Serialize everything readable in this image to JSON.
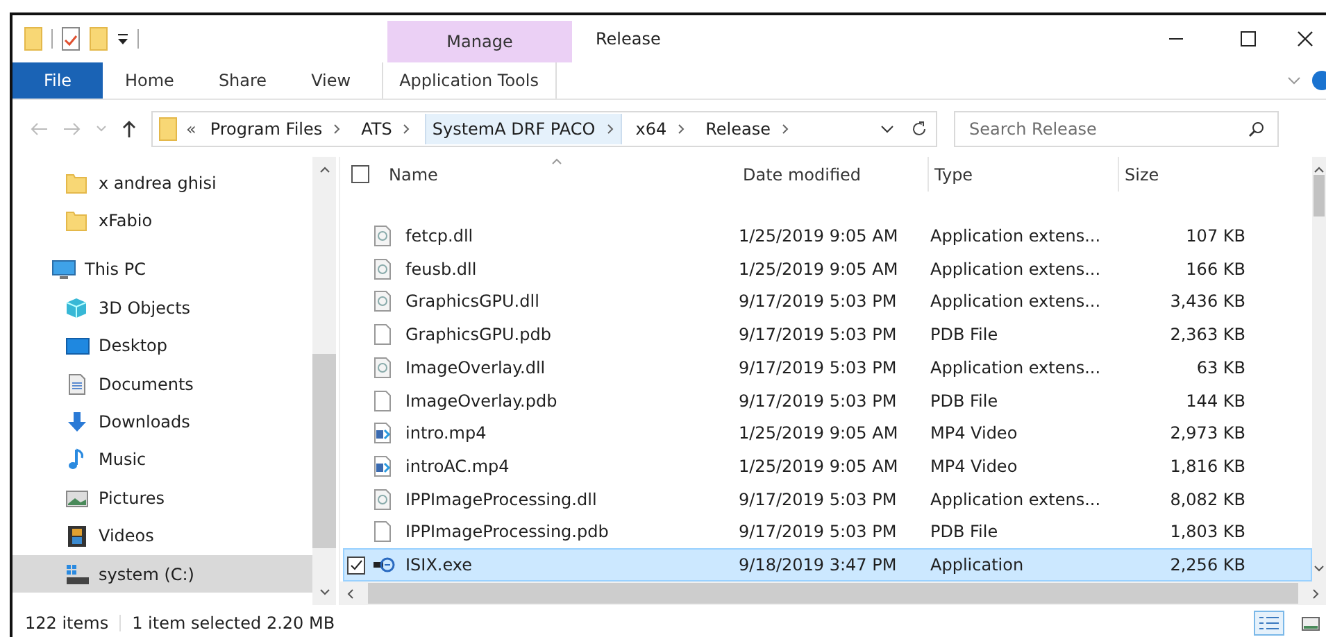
{
  "window": {
    "title": "Release",
    "contextual_group": "Manage"
  },
  "tabs": [
    {
      "label": "File",
      "selected": true
    },
    {
      "label": "Home",
      "selected": false
    },
    {
      "label": "Share",
      "selected": false
    },
    {
      "label": "View",
      "selected": false
    },
    {
      "label": "Application Tools",
      "selected": false
    }
  ],
  "address": {
    "overflow": "«",
    "crumbs": [
      {
        "label": "Program Files",
        "hover": false
      },
      {
        "label": "ATS",
        "hover": false
      },
      {
        "label": "SystemA DRF PACO",
        "hover": true
      },
      {
        "label": "x64",
        "hover": false
      },
      {
        "label": "Release",
        "hover": false
      }
    ]
  },
  "search": {
    "placeholder": "Search Release"
  },
  "sidebar": {
    "items": [
      {
        "label": "x andrea ghisi",
        "kind": "folder",
        "selected": false
      },
      {
        "label": "xFabio",
        "kind": "folder",
        "selected": false
      },
      {
        "label": "This PC",
        "kind": "pc",
        "selected": false,
        "children": [
          {
            "label": "3D Objects",
            "kind": "objects",
            "selected": false
          },
          {
            "label": "Desktop",
            "kind": "desktop",
            "selected": false
          },
          {
            "label": "Documents",
            "kind": "documents",
            "selected": false
          },
          {
            "label": "Downloads",
            "kind": "downloads",
            "selected": false
          },
          {
            "label": "Music",
            "kind": "music",
            "selected": false
          },
          {
            "label": "Pictures",
            "kind": "pictures",
            "selected": false
          },
          {
            "label": "Videos",
            "kind": "videos",
            "selected": false
          },
          {
            "label": "system (C:)",
            "kind": "drive",
            "selected": true
          }
        ]
      }
    ]
  },
  "table": {
    "select_all_checked": false,
    "columns": [
      "Name",
      "Date modified",
      "Type",
      "Size"
    ],
    "rows": [
      {
        "name": "fetcp.dll",
        "kind": "dll",
        "date": "1/25/2019 9:05 AM",
        "type": "Application extens...",
        "size": "107 KB",
        "selected": false
      },
      {
        "name": "feusb.dll",
        "kind": "dll",
        "date": "1/25/2019 9:05 AM",
        "type": "Application extens...",
        "size": "166 KB",
        "selected": false
      },
      {
        "name": "GraphicsGPU.dll",
        "kind": "dll",
        "date": "9/17/2019 5:03 PM",
        "type": "Application extens...",
        "size": "3,436 KB",
        "selected": false
      },
      {
        "name": "GraphicsGPU.pdb",
        "kind": "pdb",
        "date": "9/17/2019 5:03 PM",
        "type": "PDB File",
        "size": "2,363 KB",
        "selected": false
      },
      {
        "name": "ImageOverlay.dll",
        "kind": "dll",
        "date": "9/17/2019 5:03 PM",
        "type": "Application extens...",
        "size": "63 KB",
        "selected": false
      },
      {
        "name": "ImageOverlay.pdb",
        "kind": "pdb",
        "date": "9/17/2019 5:03 PM",
        "type": "PDB File",
        "size": "144 KB",
        "selected": false
      },
      {
        "name": "intro.mp4",
        "kind": "mp4",
        "date": "1/25/2019 9:05 AM",
        "type": "MP4 Video",
        "size": "2,973 KB",
        "selected": false
      },
      {
        "name": "introAC.mp4",
        "kind": "mp4",
        "date": "1/25/2019 9:05 AM",
        "type": "MP4 Video",
        "size": "1,816 KB",
        "selected": false
      },
      {
        "name": "IPPImageProcessing.dll",
        "kind": "dll",
        "date": "9/17/2019 5:03 PM",
        "type": "Application extens...",
        "size": "8,082 KB",
        "selected": false
      },
      {
        "name": "IPPImageProcessing.pdb",
        "kind": "pdb",
        "date": "9/17/2019 5:03 PM",
        "type": "PDB File",
        "size": "1,803 KB",
        "selected": false
      },
      {
        "name": "ISIX.exe",
        "kind": "exe",
        "date": "9/18/2019 3:47 PM",
        "type": "Application",
        "size": "2,256 KB",
        "selected": true
      }
    ]
  },
  "status_bar": {
    "count": "122 items",
    "selection": "1 item selected  2.20 MB"
  }
}
